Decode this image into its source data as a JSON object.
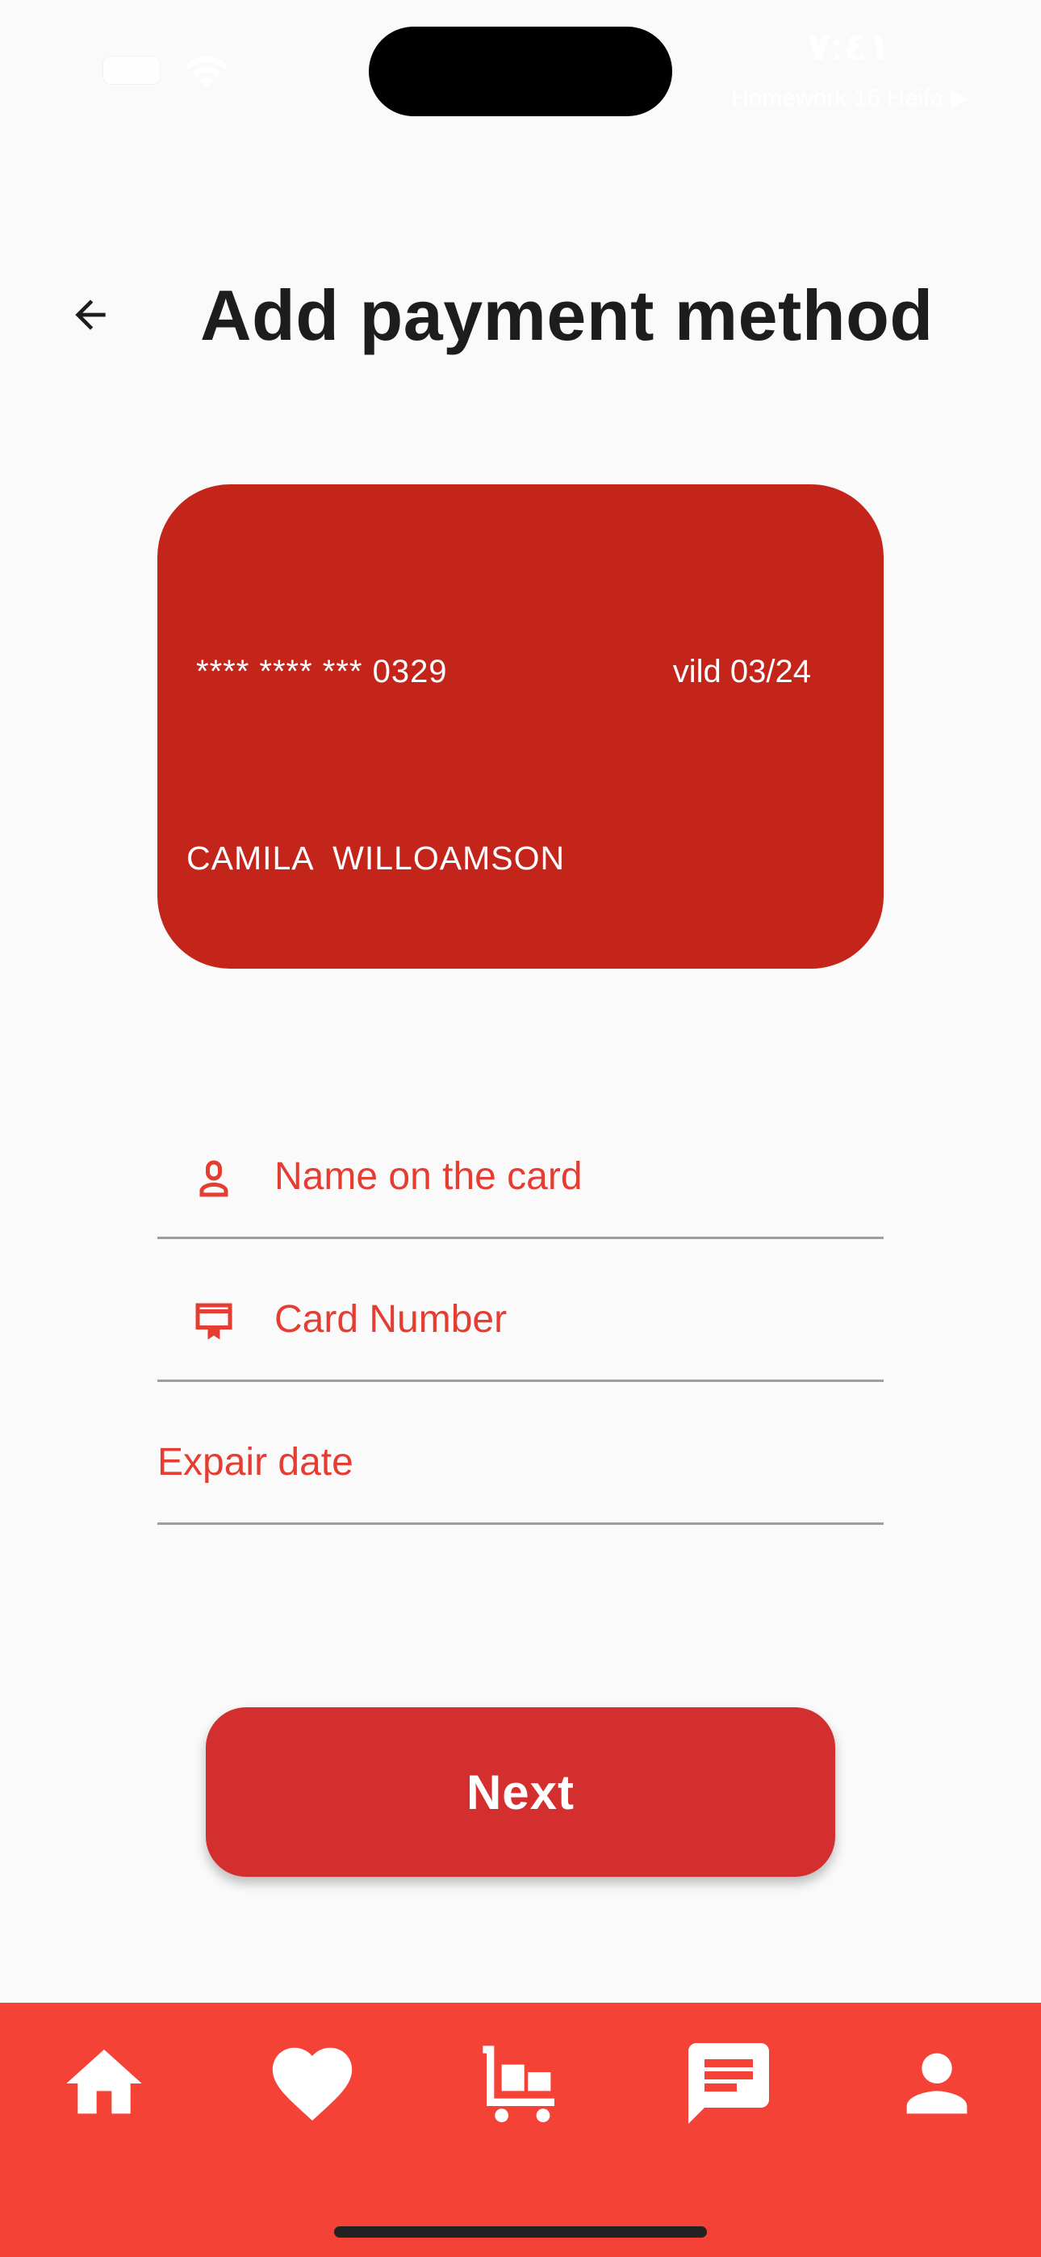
{
  "status_bar": {
    "time": "٧:٤١",
    "back_to_app": "Homework 16 Haifa ▶"
  },
  "header": {
    "title": "Add payment method",
    "back_icon": "arrow-left-icon"
  },
  "card": {
    "number": "**** **** *** 0329",
    "valid": "vild  03/24",
    "holder": "CAMILA  WILLOAMSON",
    "color": "#c4251b"
  },
  "form": {
    "name_placeholder": "Name on the card",
    "name_icon": "person-icon",
    "number_placeholder": "Card Number",
    "number_icon": "credit-card-icon",
    "expiry_placeholder": "Expair date",
    "accent_color": "#e53d31"
  },
  "actions": {
    "next_label": "Next"
  },
  "bottom_nav": {
    "background": "#f44336",
    "items": [
      {
        "icon": "home-icon"
      },
      {
        "icon": "heart-icon"
      },
      {
        "icon": "cart-icon"
      },
      {
        "icon": "chat-icon"
      },
      {
        "icon": "person-icon"
      }
    ]
  }
}
